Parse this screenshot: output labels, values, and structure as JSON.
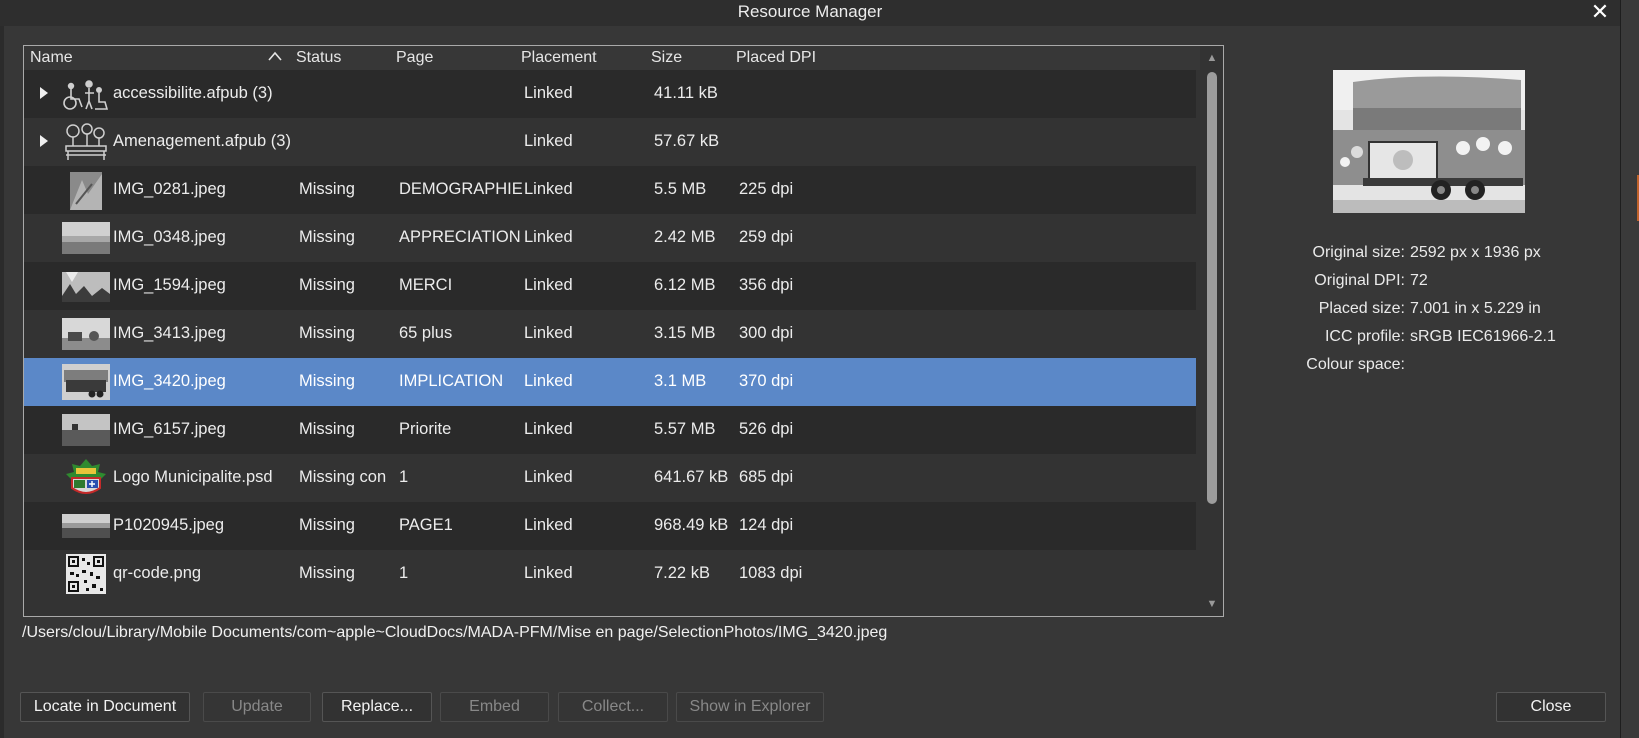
{
  "window": {
    "title": "Resource Manager"
  },
  "table": {
    "columns": {
      "name": "Name",
      "status": "Status",
      "page": "Page",
      "placement": "Placement",
      "size": "Size",
      "placed_dpi": "Placed DPI"
    },
    "rows": [
      {
        "name": "accessibilite.afpub (3)",
        "status": "",
        "page": "",
        "placement": "Linked",
        "size": "41.11 kB",
        "dpi": ""
      },
      {
        "name": "Amenagement.afpub (3)",
        "status": "",
        "page": "",
        "placement": "Linked",
        "size": "57.67 kB",
        "dpi": ""
      },
      {
        "name": "IMG_0281.jpeg",
        "status": "Missing",
        "page": "DEMOGRAPHIE",
        "placement": "Linked",
        "size": "5.5 MB",
        "dpi": "225 dpi"
      },
      {
        "name": "IMG_0348.jpeg",
        "status": "Missing",
        "page": "APPRECIATION",
        "placement": "Linked",
        "size": "2.42 MB",
        "dpi": "259 dpi"
      },
      {
        "name": "IMG_1594.jpeg",
        "status": "Missing",
        "page": "MERCI",
        "placement": "Linked",
        "size": "6.12 MB",
        "dpi": "356 dpi"
      },
      {
        "name": "IMG_3413.jpeg",
        "status": "Missing",
        "page": "65 plus",
        "placement": "Linked",
        "size": "3.15 MB",
        "dpi": "300 dpi"
      },
      {
        "name": "IMG_3420.jpeg",
        "status": "Missing",
        "page": "IMPLICATION",
        "placement": "Linked",
        "size": "3.1 MB",
        "dpi": "370 dpi"
      },
      {
        "name": "IMG_6157.jpeg",
        "status": "Missing",
        "page": "Priorite",
        "placement": "Linked",
        "size": "5.57 MB",
        "dpi": "526 dpi"
      },
      {
        "name": "Logo Municipalite.psd",
        "status": "Missing con",
        "page": "1",
        "placement": "Linked",
        "size": "641.67 kB",
        "dpi": "685 dpi"
      },
      {
        "name": "P1020945.jpeg",
        "status": "Missing",
        "page": "PAGE1",
        "placement": "Linked",
        "size": "968.49 kB",
        "dpi": "124 dpi"
      },
      {
        "name": "qr-code.png",
        "status": "Missing",
        "page": "1",
        "placement": "Linked",
        "size": "7.22 kB",
        "dpi": "1083 dpi"
      }
    ],
    "selected_row": "IMG_3420.jpeg"
  },
  "path": "/Users/clou/Library/Mobile Documents/com~apple~CloudDocs/MADA-PFM/Mise en page/SelectionPhotos/IMG_3420.jpeg",
  "info": {
    "original_size_label": "Original size:",
    "original_size": "2592 px x 1936 px",
    "original_dpi_label": "Original DPI:",
    "original_dpi": "72",
    "placed_size_label": "Placed size:",
    "placed_size": "7.001 in x 5.229 in",
    "icc_profile_label": "ICC profile:",
    "icc_profile": "sRGB IEC61966-2.1",
    "colour_space_label": "Colour space:",
    "colour_space": ""
  },
  "buttons": {
    "locate": "Locate in Document",
    "update": "Update",
    "replace": "Replace...",
    "embed": "Embed",
    "collect": "Collect...",
    "show_explorer": "Show in Explorer",
    "close": "Close"
  },
  "colors": {
    "background": "#373737",
    "selection": "#5b88c8",
    "accent_edge": "#c0622b"
  }
}
